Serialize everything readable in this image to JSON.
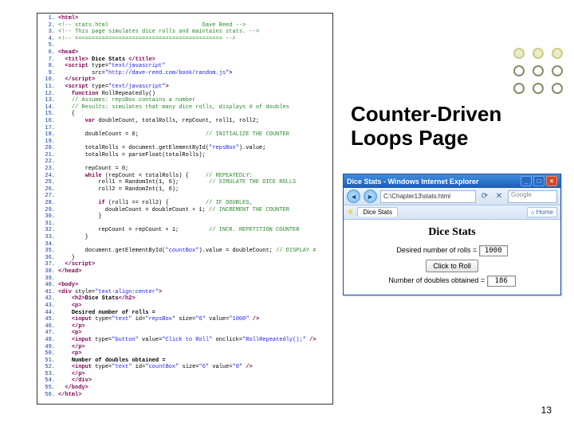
{
  "title": {
    "line1": "Counter-Driven",
    "line2": "Loops Page"
  },
  "page_number": "13",
  "code": {
    "lines": [
      {
        "n": "1.",
        "html": "<span class='ck'>&lt;html&gt;</span>"
      },
      {
        "n": "2.",
        "html": "<span class='cc'>&lt;!-- stats.html                            Dave Reed --&gt;</span>"
      },
      {
        "n": "3.",
        "html": "<span class='cc'>&lt;!-- This page simulates dice rolls and maintains stats. --&gt;</span>"
      },
      {
        "n": "4.",
        "html": "<span class='cc'>&lt;!-- ============================================ --&gt;</span>"
      },
      {
        "n": "5.",
        "html": ""
      },
      {
        "n": "6.",
        "html": "<span class='ck'>&lt;head&gt;</span>"
      },
      {
        "n": "7.",
        "html": "  <span class='ck'>&lt;title&gt;</span> <span class='cbold'>Dice Stats</span> <span class='ck'>&lt;/title&gt;</span>"
      },
      {
        "n": "8.",
        "html": "  <span class='ck'>&lt;script</span> type=<span class='cs'>\"text/javascript\"</span>"
      },
      {
        "n": "9.",
        "html": "          src=<span class='cs'>\"http://dave-reed.com/book/random.js\"</span><span class='ck'>&gt;</span>"
      },
      {
        "n": "10.",
        "html": "  <span class='ck'>&lt;/script&gt;</span>"
      },
      {
        "n": "11.",
        "html": "  <span class='ck'>&lt;script</span> type=<span class='cs'>\"text/javascript\"</span><span class='ck'>&gt;</span>"
      },
      {
        "n": "12.",
        "html": "    <span class='ck'>function</span> RollRepeatedly()"
      },
      {
        "n": "13.",
        "html": "    <span class='cc'>// Assumes: repsBox contains a number</span>"
      },
      {
        "n": "14.",
        "html": "    <span class='cc'>// Results: simulates that many dice rolls, displays # of doubles</span>"
      },
      {
        "n": "15.",
        "html": "    {"
      },
      {
        "n": "16.",
        "html": "        <span class='ck'>var</span> doubleCount, totalRolls, repCount, roll1, roll2;"
      },
      {
        "n": "17.",
        "html": ""
      },
      {
        "n": "18.",
        "html": "        doubleCount = 0;                    <span class='cc'>// INITIALIZE THE COUNTER</span>"
      },
      {
        "n": "19.",
        "html": ""
      },
      {
        "n": "20.",
        "html": "        totalRolls = document.getElementById(<span class='cs'>\"repsBox\"</span>).value;"
      },
      {
        "n": "21.",
        "html": "        totalRolls = parseFloat(totalRolls);"
      },
      {
        "n": "22.",
        "html": ""
      },
      {
        "n": "23.",
        "html": "        repCount = 0;"
      },
      {
        "n": "24.",
        "html": "        <span class='ck'>while</span> (repCount &lt; totalRolls) {     <span class='cc'>// REPEATEDLY:</span>"
      },
      {
        "n": "25.",
        "html": "            roll1 = RandomInt(1, 6);         <span class='cc'>// SIMULATE THE DICE ROLLS</span>"
      },
      {
        "n": "26.",
        "html": "            roll2 = RandomInt(1, 6);"
      },
      {
        "n": "27.",
        "html": ""
      },
      {
        "n": "28.",
        "html": "            <span class='ck'>if</span> (roll1 == roll2) {           <span class='cc'>// IF DOUBLES,</span>"
      },
      {
        "n": "29.",
        "html": "              doubleCount = doubleCount + 1; <span class='cc'>// INCREMENT THE COUNTER</span>"
      },
      {
        "n": "30.",
        "html": "            }"
      },
      {
        "n": "31.",
        "html": ""
      },
      {
        "n": "32.",
        "html": "            repCount = repCount + 1;         <span class='cc'>// INCR. REPETITION COUNTER</span>"
      },
      {
        "n": "33.",
        "html": "        }"
      },
      {
        "n": "34.",
        "html": ""
      },
      {
        "n": "35.",
        "html": "        document.getElementById(<span class='cs'>\"countBox\"</span>).value = doubleCount; <span class='cc'>// DISPLAY #</span>"
      },
      {
        "n": "36.",
        "html": "    }"
      },
      {
        "n": "37.",
        "html": "  <span class='ck'>&lt;/script&gt;</span>"
      },
      {
        "n": "38.",
        "html": "<span class='ck'>&lt;/head&gt;</span>"
      },
      {
        "n": "39.",
        "html": ""
      },
      {
        "n": "40.",
        "html": "<span class='ck'>&lt;body&gt;</span>"
      },
      {
        "n": "41.",
        "html": "<span class='ck'>&lt;div</span> style=<span class='cs'>\"text-align:center\"</span><span class='ck'>&gt;</span>"
      },
      {
        "n": "42.",
        "html": "    <span class='ck'>&lt;h2&gt;</span><span class='cbold'>Dice Stats</span><span class='ck'>&lt;/h2&gt;</span>"
      },
      {
        "n": "43.",
        "html": "    <span class='ck'>&lt;p&gt;</span>"
      },
      {
        "n": "44.",
        "html": "    <span class='cbold'>Desired number of rolls =</span>"
      },
      {
        "n": "45.",
        "html": "    <span class='ck'>&lt;input</span> type=<span class='cs'>\"text\"</span> id=<span class='cs'>\"repsBox\"</span> size=<span class='cs'>\"6\"</span> value=<span class='cs'>\"1000\"</span> <span class='ck'>/&gt;</span>"
      },
      {
        "n": "46.",
        "html": "    <span class='ck'>&lt;/p&gt;</span>"
      },
      {
        "n": "47.",
        "html": "    <span class='ck'>&lt;p&gt;</span>"
      },
      {
        "n": "48.",
        "html": "    <span class='ck'>&lt;input</span> type=<span class='cs'>\"button\"</span> value=<span class='cs'>\"Click to Roll\"</span> onclick=<span class='cs'>\"RollRepeatedly();\"</span> <span class='ck'>/&gt;</span>"
      },
      {
        "n": "49.",
        "html": "    <span class='ck'>&lt;/p&gt;</span>"
      },
      {
        "n": "50.",
        "html": "    <span class='ck'>&lt;p&gt;</span>"
      },
      {
        "n": "51.",
        "html": "    <span class='cbold'>Number of doubles obtained =</span>"
      },
      {
        "n": "52.",
        "html": "    <span class='ck'>&lt;input</span> type=<span class='cs'>\"text\"</span> id=<span class='cs'>\"countBox\"</span> size=<span class='cs'>\"6\"</span> value=<span class='cs'>\"0\"</span> <span class='ck'>/&gt;</span>"
      },
      {
        "n": "53.",
        "html": "    <span class='ck'>&lt;/p&gt;</span>"
      },
      {
        "n": "54.",
        "html": "    <span class='ck'>&lt;/div&gt;</span>"
      },
      {
        "n": "55.",
        "html": "  <span class='ck'>&lt;/body&gt;</span>"
      },
      {
        "n": "56.",
        "html": "<span class='ck'>&lt;/html&gt;</span>"
      }
    ]
  },
  "browser": {
    "window_title": "Dice Stats - Windows Internet Explorer",
    "address": "C:\\Chapter13\\stats.html",
    "search_placeholder": "Google",
    "tab_label": "Dice Stats",
    "home_label": "Home",
    "page_heading": "Dice Stats",
    "label_rolls": "Desired number of rolls =",
    "input_rolls": "1000",
    "button_label": "Click to Roll",
    "label_doubles": "Number of doubles obtained =",
    "input_doubles": "186"
  }
}
